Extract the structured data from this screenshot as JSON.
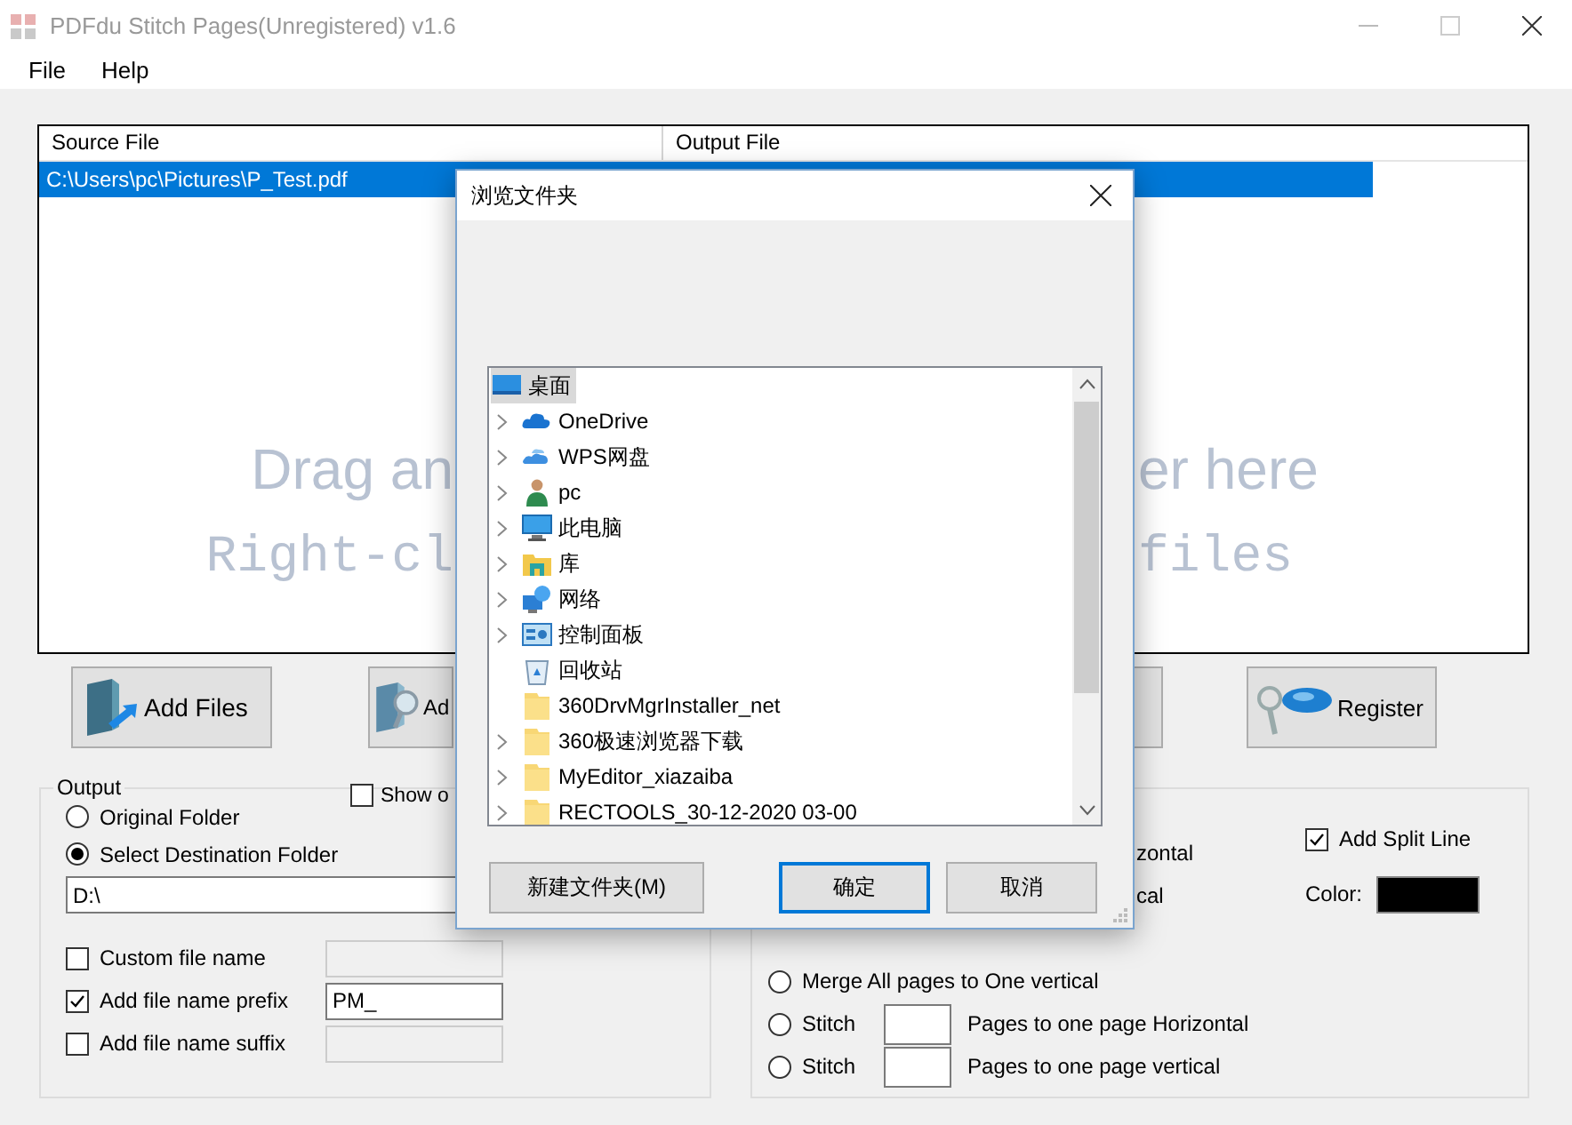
{
  "window": {
    "title": "PDFdu Stitch Pages(Unregistered) v1.6"
  },
  "menu": [
    "File",
    "Help"
  ],
  "file_list": {
    "columns": [
      "Source File",
      "Output File"
    ],
    "rows": [
      {
        "source": "C:\\Users\\pc\\Pictures\\P_Test.pdf",
        "selected": true
      }
    ],
    "hint_lines": [
      {
        "kind": "sans",
        "left": "Drag an",
        "right": "er here"
      },
      {
        "kind": "mono",
        "left": "Right-cl",
        "right": "files"
      }
    ]
  },
  "buttons": [
    {
      "kind": "add-files",
      "label": "Add Files"
    },
    {
      "kind": "add-folder",
      "label": "Ad"
    },
    {
      "kind": "blank"
    },
    {
      "kind": "register",
      "label": "Register"
    }
  ],
  "output": {
    "title": "Output",
    "options": [
      {
        "label": "Original Folder",
        "selected": false
      },
      {
        "label": "Select Destination Folder",
        "selected": true
      }
    ],
    "show_option": {
      "label": "Show o",
      "checked": false
    },
    "folder": "D:\\",
    "name_options": [
      {
        "label": "Custom file name",
        "checked": false,
        "disabled": true
      },
      {
        "label": "Add file name prefix",
        "checked": true,
        "disabled": false,
        "value": "PM_"
      },
      {
        "label": "Add file name suffix",
        "checked": false,
        "disabled": true
      }
    ]
  },
  "merge": {
    "options": [
      {
        "kind": "fragment",
        "label": "zontal"
      },
      {
        "kind": "fragment",
        "label": "cal"
      },
      {
        "kind": "spacer"
      },
      {
        "kind": "radio",
        "label": "Merge All pages to One vertical",
        "selected": false
      },
      {
        "kind": "stitch",
        "label": "Stitch",
        "suffix": "Pages to one page Horizontal",
        "selected": false
      },
      {
        "kind": "stitch",
        "label": "Stitch",
        "suffix": "Pages to one page vertical",
        "selected": false
      }
    ],
    "split_line": {
      "label": "Add Split Line",
      "checked": true
    },
    "color_label": "Color:",
    "color": "#000000"
  },
  "dialog": {
    "title": "浏览文件夹",
    "tree": [
      {
        "label": "桌面",
        "kind": "desktop",
        "selected": true,
        "children": [
          {
            "label": "OneDrive",
            "kind": "cloud",
            "expandable": true,
            "selected": false
          },
          {
            "label": "WPS网盘",
            "kind": "cloud-pair",
            "expandable": true,
            "selected": false
          },
          {
            "label": "pc",
            "kind": "user",
            "expandable": true,
            "selected": false
          },
          {
            "label": "此电脑",
            "kind": "computer",
            "expandable": true,
            "selected": false
          },
          {
            "label": "库",
            "kind": "library",
            "expandable": true,
            "selected": false
          },
          {
            "label": "网络",
            "kind": "network",
            "expandable": true,
            "selected": false
          },
          {
            "label": "控制面板",
            "kind": "control-panel",
            "expandable": true,
            "selected": false
          },
          {
            "label": "回收站",
            "kind": "recycle-bin",
            "expandable": false,
            "selected": false
          },
          {
            "label": "360DrvMgrInstaller_net",
            "kind": "folder",
            "expandable": false,
            "selected": false
          },
          {
            "label": "360极速浏览器下载",
            "kind": "folder",
            "expandable": true,
            "selected": false
          },
          {
            "label": "MyEditor_xiazaiba",
            "kind": "folder",
            "expandable": true,
            "selected": false
          },
          {
            "label": "RECTOOLS_30-12-2020 03-00",
            "kind": "folder",
            "expandable": true,
            "selected": false
          }
        ]
      }
    ],
    "buttons": [
      {
        "label": "新建文件夹(M)",
        "default": false
      },
      {
        "label": "确定",
        "default": true
      },
      {
        "label": "取消",
        "default": false
      }
    ]
  }
}
